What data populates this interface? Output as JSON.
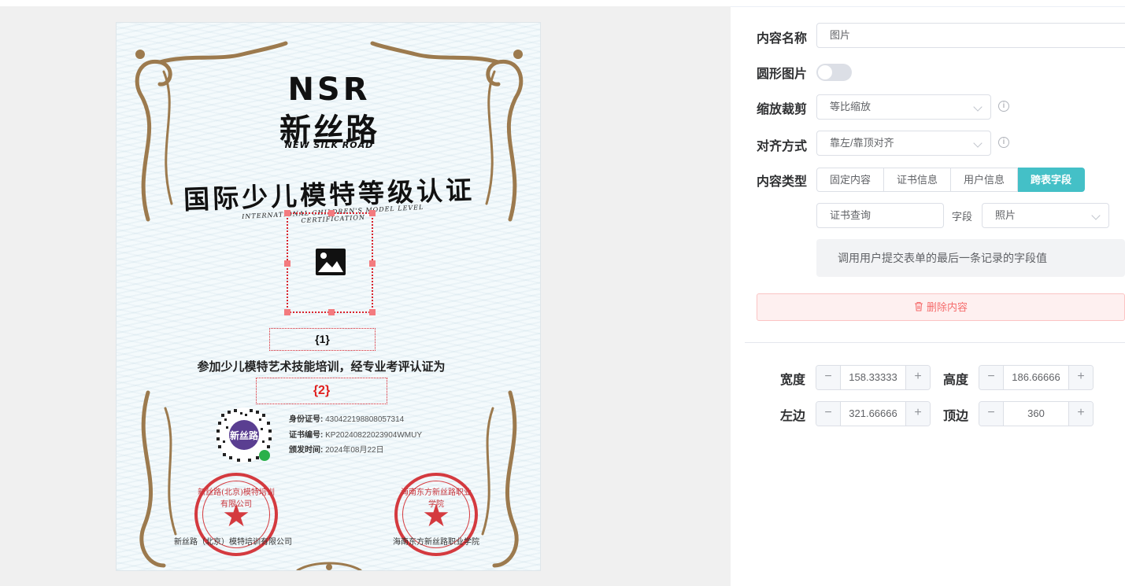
{
  "certificate": {
    "logo_latin": "NSR",
    "logo_cn": "新丝路",
    "logo_sub": "NEW SILK ROAD",
    "title": "国际少儿模特等级认证",
    "subtitle": "INTERNATIONAL CHILDREN'S MODEL LEVEL CERTIFICATION",
    "field1": "{1}",
    "body_text": "参加少儿模特艺术技能培训，经专业考评认证为",
    "field2": "{2}",
    "id_label": "身份证号:",
    "id_value": "430422198808057314",
    "cert_no_label": "证书编号:",
    "cert_no_value": "KP20240822023904WMUY",
    "issue_label": "颁发时间:",
    "issue_value": "2024年08月22日",
    "seal1_text": "新丝路(北京)模特培训有限公司",
    "seal2_text": "海南东方新丝路职业学院",
    "caption1": "新丝路（北京）模特培训有限公司",
    "caption2": "海南东方新丝路职业学院",
    "accent_red": "#d9232d",
    "frame_gold": "#9c7a4e"
  },
  "panel": {
    "content_name_label": "内容名称",
    "content_name_value": "图片",
    "round_image_label": "圆形图片",
    "round_image_on": false,
    "scale_crop_label": "缩放裁剪",
    "scale_crop_value": "等比缩放",
    "align_label": "对齐方式",
    "align_value": "靠左/靠顶对齐",
    "content_type_label": "内容类型",
    "content_types": [
      "固定内容",
      "证书信息",
      "用户信息",
      "跨表字段"
    ],
    "active_type": "跨表字段",
    "form_value": "证书查询",
    "field_label": "字段",
    "field_value": "照片",
    "hint": "调用用户提交表单的最后一条记录的字段值",
    "delete_label": "删除内容",
    "width_label": "宽度",
    "width_value": "158.33333",
    "height_label": "高度",
    "height_value": "186.66666",
    "left_label": "左边",
    "left_value": "321.66666",
    "top_label": "顶边",
    "top_value": "360",
    "accent": "#44c0c7"
  }
}
